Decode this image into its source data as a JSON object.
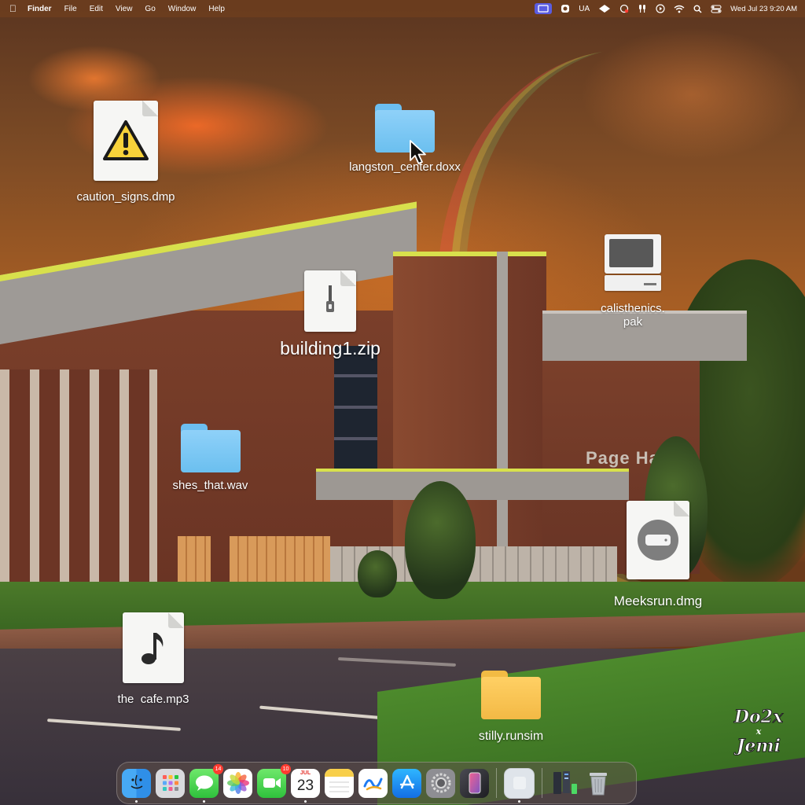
{
  "menubar": {
    "apple_icon": "apple-icon",
    "items": [
      "Finder",
      "File",
      "Edit",
      "View",
      "Go",
      "Window",
      "Help"
    ],
    "status": {
      "screen_share": "screen-share-icon",
      "vpn": "vpn-icon",
      "input_source": "UA",
      "extra_icons": [
        "diamond-icon",
        "record-icon",
        "airpods-icon",
        "play-icon",
        "wifi-icon",
        "search-icon",
        "control-center-icon"
      ],
      "clock": "Wed Jul 23  9:20 AM"
    }
  },
  "desktop": {
    "icons": [
      {
        "label": "caution_signs.dmp",
        "kind": "document",
        "glyph": "warning-icon"
      },
      {
        "label": "langston_center.doxx",
        "kind": "folder",
        "color": "#8fd1f9"
      },
      {
        "label": "building1.zip",
        "kind": "archive",
        "glyph": "zipper-icon"
      },
      {
        "label": "calisthenics.\npak",
        "kind": "computer"
      },
      {
        "label": "shes_that.wav",
        "kind": "folder",
        "color": "#8fd1f9"
      },
      {
        "label": "Meeksrun.dmg",
        "kind": "disk-image",
        "glyph": "disk-icon"
      },
      {
        "label": "the  cafe.mp3",
        "kind": "audio",
        "glyph": "music-note-icon"
      },
      {
        "label": "stilly.runsim",
        "kind": "folder",
        "color": "#ffd064"
      }
    ],
    "wallpaper_sign": "Page Hal"
  },
  "watermark": {
    "line1": "Do2x",
    "line2": "x",
    "line3": "Jemi"
  },
  "dock": {
    "apps": [
      {
        "name": "Finder",
        "icon": "finder-icon",
        "running": true
      },
      {
        "name": "Launchpad",
        "icon": "launchpad-icon",
        "running": false
      },
      {
        "name": "Messages",
        "icon": "messages-icon",
        "badge": "14",
        "running": true
      },
      {
        "name": "Photos",
        "icon": "photos-icon",
        "running": false
      },
      {
        "name": "FaceTime",
        "icon": "facetime-icon",
        "badge": "10",
        "running": false
      },
      {
        "name": "Calendar",
        "icon": "calendar-icon",
        "month": "JUL",
        "day": "23",
        "running": true
      },
      {
        "name": "Notes",
        "icon": "notes-icon",
        "running": true
      },
      {
        "name": "Freeform",
        "icon": "freeform-icon",
        "running": false
      },
      {
        "name": "App Store",
        "icon": "app-store-icon",
        "running": false
      },
      {
        "name": "System Settings",
        "icon": "settings-icon",
        "running": false
      },
      {
        "name": "iPhone Mirroring",
        "icon": "iphone-mirroring-icon",
        "running": false
      },
      {
        "name": "Preview",
        "icon": "blank-app-icon",
        "running": true
      },
      {
        "name": "Downloads",
        "icon": "downloads-stack-icon",
        "running": false
      },
      {
        "name": "Trash",
        "icon": "trash-icon",
        "running": false
      }
    ]
  },
  "colors": {
    "menubar": "#6e3e1e",
    "folder_blue": "#8fd1f9",
    "folder_yellow": "#ffd064",
    "badge_red": "#ff3b30",
    "warning_yellow": "#f7d23a"
  }
}
